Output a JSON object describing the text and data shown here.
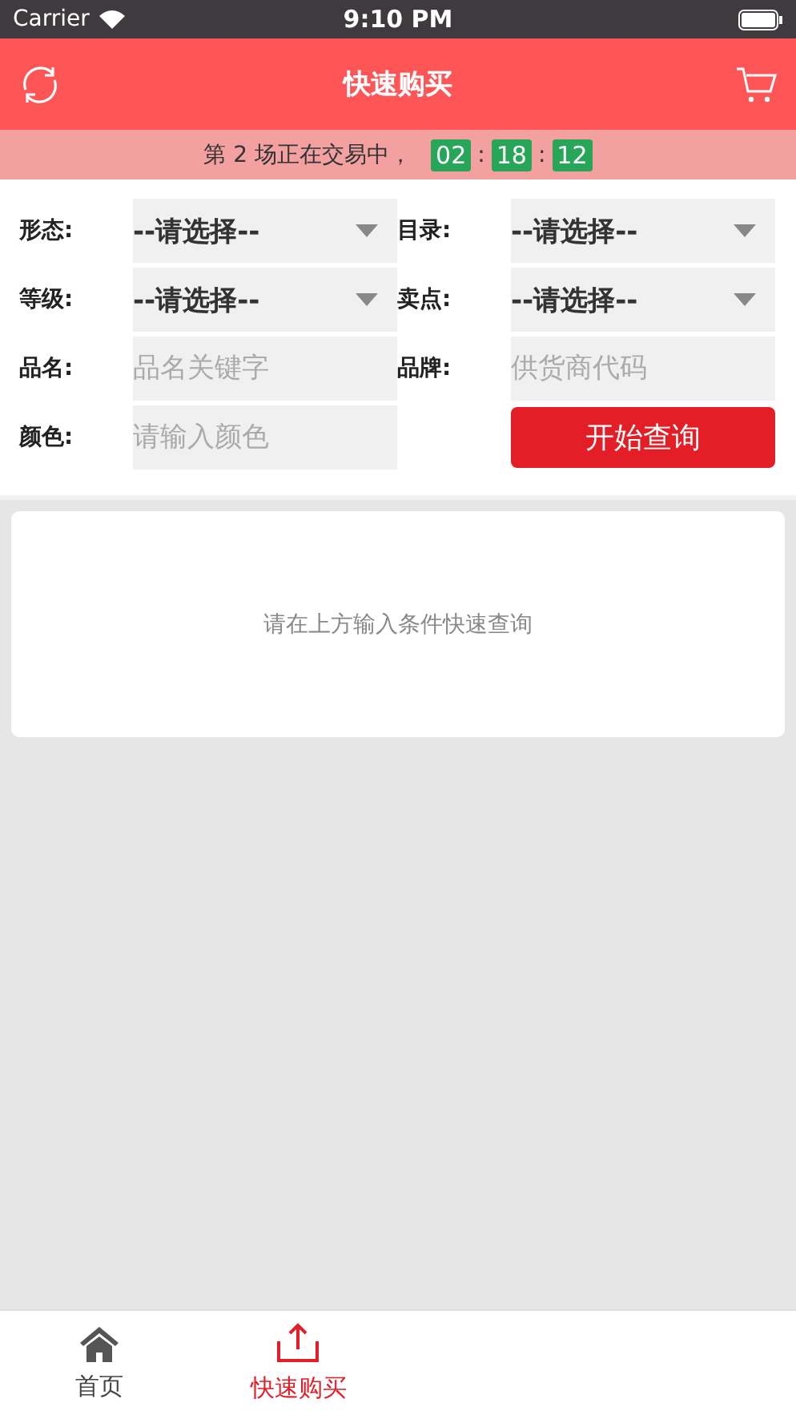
{
  "status_bar": {
    "carrier": "Carrier",
    "time": "9:10 PM"
  },
  "nav": {
    "title": "快速购买"
  },
  "session": {
    "text": "第 2 场正在交易中，",
    "countdown": [
      "02",
      "18",
      "12"
    ],
    "separator": ":"
  },
  "form": {
    "fields": [
      {
        "kind": "select",
        "label": "形态:",
        "value": "--请选择--"
      },
      {
        "kind": "select",
        "label": "目录:",
        "value": "--请选择--"
      },
      {
        "kind": "select",
        "label": "等级:",
        "value": "--请选择--"
      },
      {
        "kind": "select",
        "label": "卖点:",
        "value": "--请选择--"
      },
      {
        "kind": "text",
        "label": "品名:",
        "placeholder": "品名关键字"
      },
      {
        "kind": "text",
        "label": "品牌:",
        "placeholder": "供货商代码"
      },
      {
        "kind": "text",
        "label": "颜色:",
        "placeholder": "请输入颜色"
      }
    ],
    "search_button": "开始查询"
  },
  "results": {
    "message": "请在上方输入条件快速查询"
  },
  "tab_bar": [
    {
      "kind": "home",
      "label": "首页",
      "selected": false
    },
    {
      "kind": "share",
      "label": "快速购买",
      "selected": true
    }
  ]
}
